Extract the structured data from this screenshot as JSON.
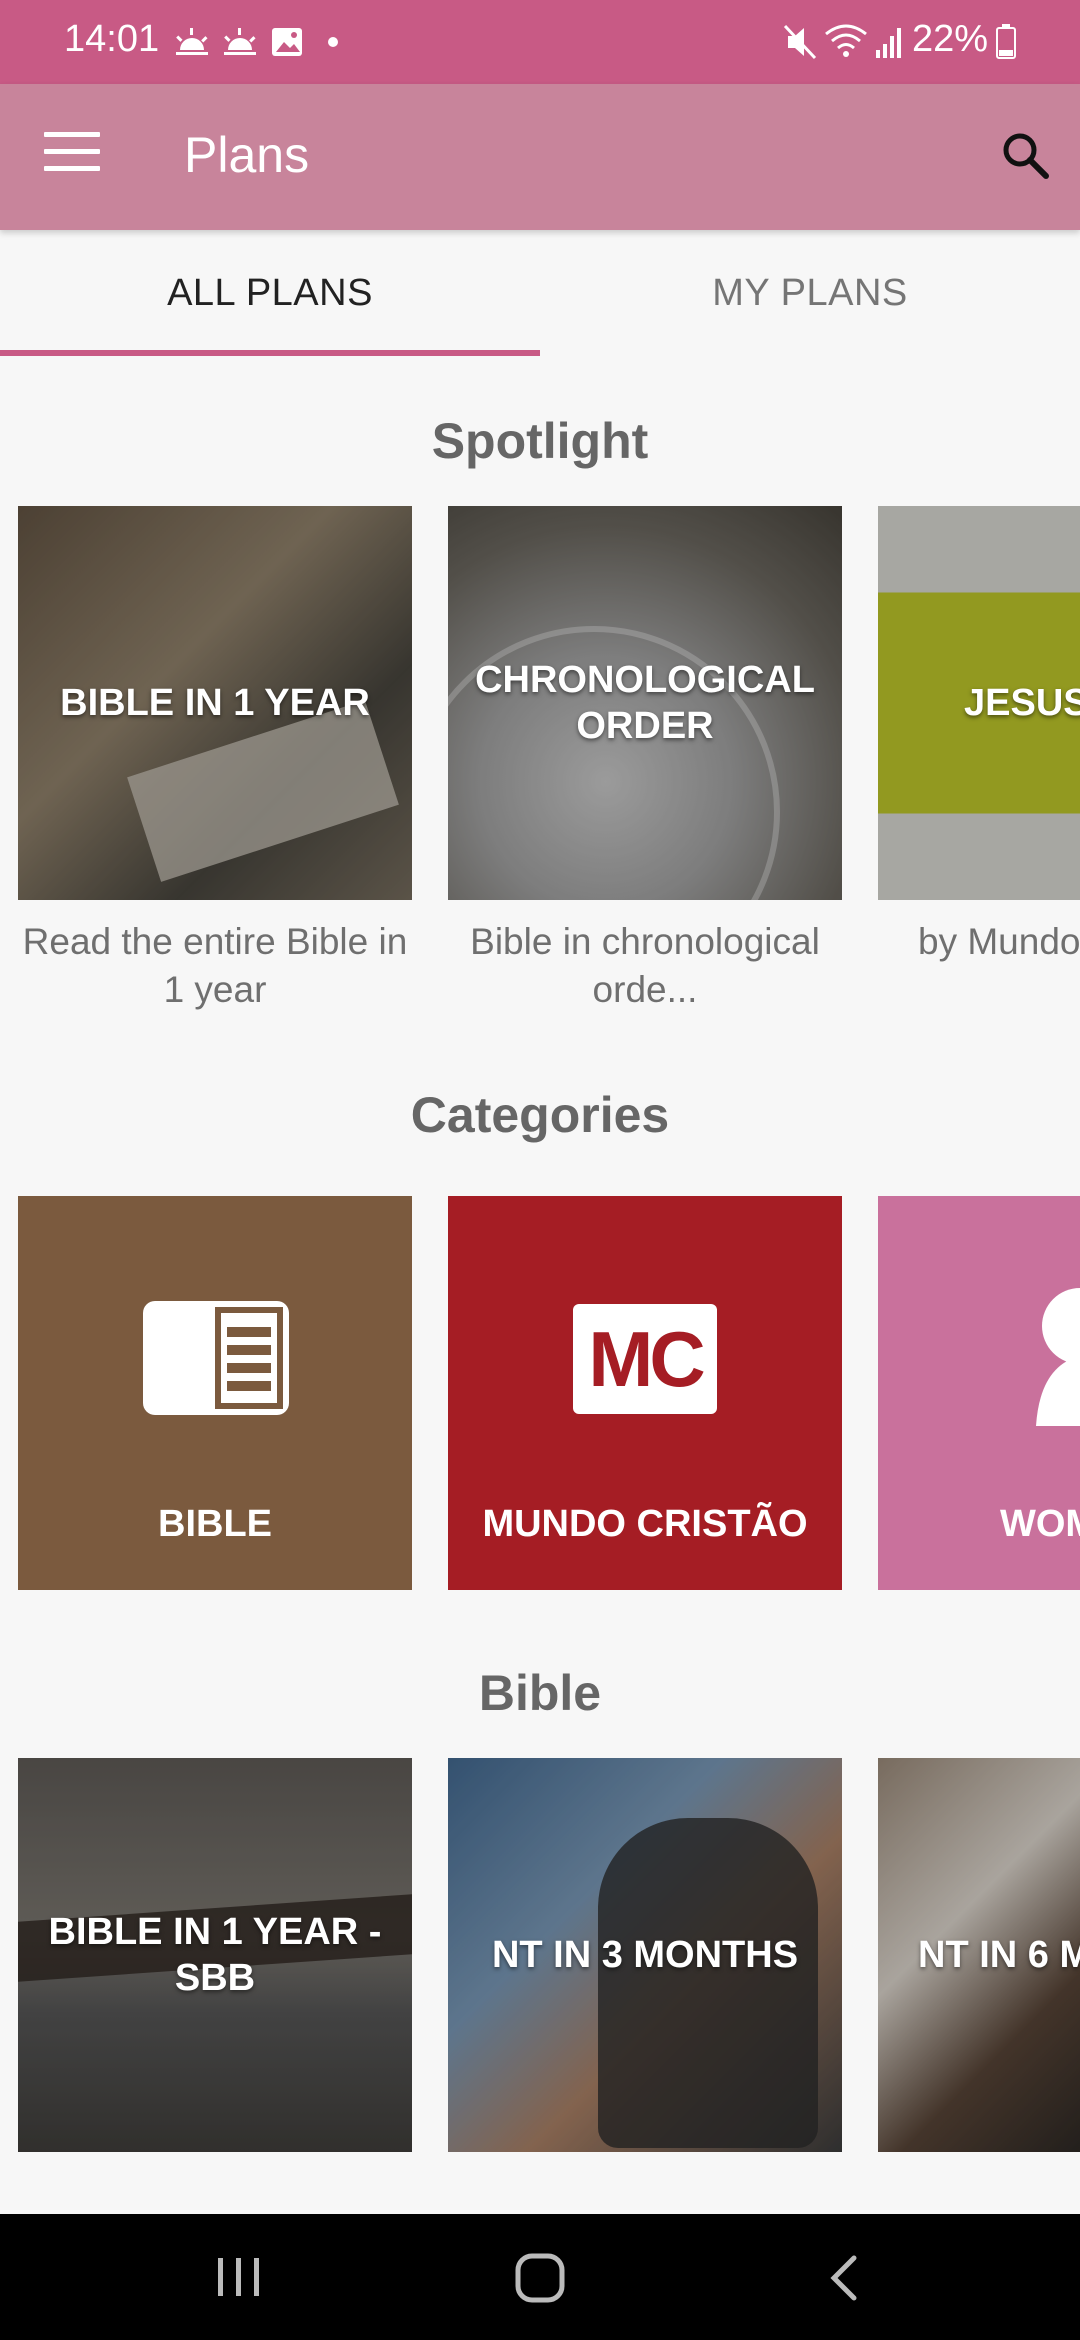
{
  "status_bar": {
    "time": "14:01",
    "battery": "22%",
    "left_icons": [
      "sunrise-icon",
      "sunrise-icon",
      "image-icon",
      "dot-icon"
    ],
    "right_icons": [
      "mute-icon",
      "wifi-icon",
      "signal-icon",
      "battery-icon"
    ]
  },
  "app_bar": {
    "title": "Plans",
    "menu_icon": "hamburger-menu-icon",
    "search_icon": "search-icon",
    "color": "#c8849b"
  },
  "tabs": [
    {
      "label": "ALL PLANS",
      "selected": true
    },
    {
      "label": "MY PLANS",
      "selected": false
    }
  ],
  "spotlight": {
    "title": "Spotlight",
    "cards": [
      {
        "label": "BIBLE IN 1 YEAR",
        "caption": "Read the entire Bible in 1 year"
      },
      {
        "label": "CHRONOLOGICAL ORDER",
        "caption": "Bible in chronological orde..."
      },
      {
        "label": "JESUS",
        "caption": "by Mundo"
      }
    ]
  },
  "categories": {
    "title": "Categories",
    "cards": [
      {
        "label": "BIBLE",
        "icon": "bible-icon",
        "color": "#7b5a3e"
      },
      {
        "label": "MUNDO CRISTÃO",
        "icon": "mc-logo-icon",
        "logo_text": "MC",
        "color": "#a51d24"
      },
      {
        "label": "WOM",
        "icon": "woman-icon",
        "color": "#c9719c"
      }
    ]
  },
  "bible": {
    "title": "Bible",
    "cards": [
      {
        "label": "BIBLE IN 1 YEAR - SBB"
      },
      {
        "label": "NT IN 3 MONTHS"
      },
      {
        "label": "NT IN 6 M"
      }
    ]
  },
  "nav_bar": {
    "icons": [
      "recents-icon",
      "home-icon",
      "back-icon"
    ]
  },
  "colors": {
    "accent": "#c85a85",
    "status_bar": "#c85a85"
  }
}
